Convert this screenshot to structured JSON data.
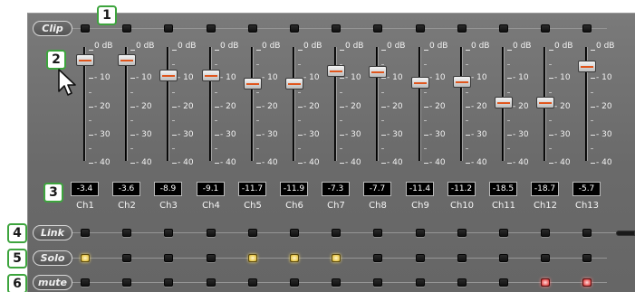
{
  "callouts": [
    "1",
    "2",
    "3",
    "4",
    "5",
    "6"
  ],
  "rows": {
    "clip": "Clip",
    "link": "Link",
    "solo": "Solo",
    "mute": "mute"
  },
  "scale": {
    "labels": [
      "0 dB",
      "- 10",
      "- 20",
      "- 30",
      "- 40"
    ],
    "db_marks": [
      0,
      -10,
      -20,
      -30,
      -40
    ]
  },
  "channels": [
    {
      "name": "Ch1",
      "value": "-3.4",
      "solo": true,
      "mute": false
    },
    {
      "name": "Ch2",
      "value": "-3.6",
      "solo": false,
      "mute": false
    },
    {
      "name": "Ch3",
      "value": "-8.9",
      "solo": false,
      "mute": false
    },
    {
      "name": "Ch4",
      "value": "-9.1",
      "solo": false,
      "mute": false
    },
    {
      "name": "Ch5",
      "value": "-11.7",
      "solo": true,
      "mute": false
    },
    {
      "name": "Ch6",
      "value": "-11.9",
      "solo": true,
      "mute": false
    },
    {
      "name": "Ch7",
      "value": "-7.3",
      "solo": true,
      "mute": false
    },
    {
      "name": "Ch8",
      "value": "-7.7",
      "solo": false,
      "mute": false
    },
    {
      "name": "Ch9",
      "value": "-11.4",
      "solo": false,
      "mute": false
    },
    {
      "name": "Ch10",
      "value": "-11.2",
      "solo": false,
      "mute": false
    },
    {
      "name": "Ch11",
      "value": "-18.5",
      "solo": false,
      "mute": false
    },
    {
      "name": "Ch12",
      "value": "-18.7",
      "solo": false,
      "mute": true
    },
    {
      "name": "Ch13",
      "value": "-5.7",
      "solo": false,
      "mute": true
    }
  ],
  "colors": {
    "panel": "#6f6f6f",
    "callout_border": "#3da43d",
    "fader_stripe": "#e0551c",
    "solo_on": "#e8c850",
    "mute_on": "#e85858"
  },
  "icons": [
    "arrow-cursor-icon"
  ]
}
